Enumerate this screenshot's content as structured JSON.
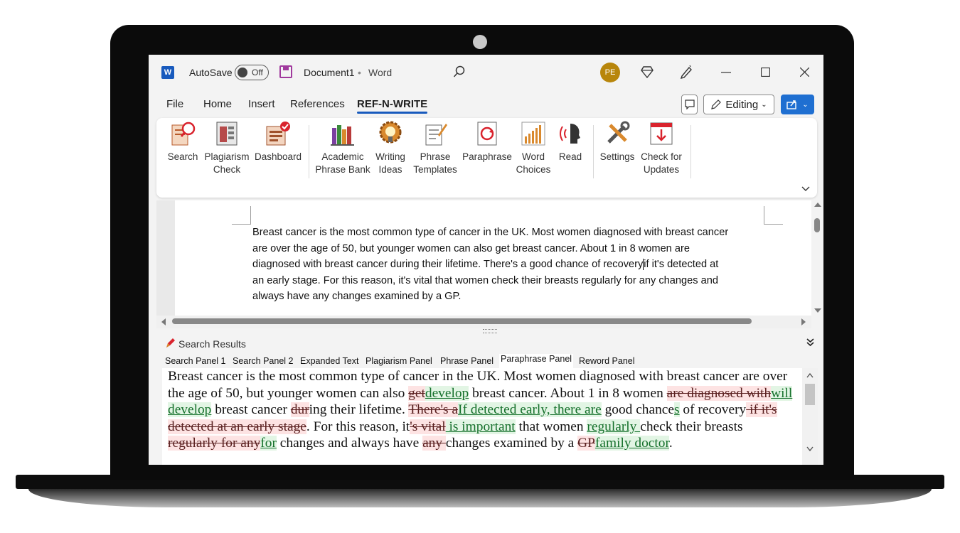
{
  "titlebar": {
    "autosave_label": "AutoSave",
    "autosave_state": "Off",
    "document_name": "Document1",
    "separator": "•",
    "app_name": "Word",
    "avatar_initials": "PE"
  },
  "menu_tabs": [
    "File",
    "Home",
    "Insert",
    "References",
    "REF-N-WRITE"
  ],
  "active_tab": "REF-N-WRITE",
  "toolbar": {
    "editing_label": "Editing"
  },
  "ribbon": {
    "buttons": [
      {
        "line1": "Search",
        "line2": ""
      },
      {
        "line1": "Plagiarism",
        "line2": "Check"
      },
      {
        "line1": "Dashboard",
        "line2": ""
      },
      {
        "line1": "Academic",
        "line2": "Phrase Bank"
      },
      {
        "line1": "Writing",
        "line2": "Ideas"
      },
      {
        "line1": "Phrase",
        "line2": "Templates"
      },
      {
        "line1": "Paraphrase",
        "line2": ""
      },
      {
        "line1": "Word",
        "line2": "Choices"
      },
      {
        "line1": "Read",
        "line2": ""
      },
      {
        "line1": "Settings",
        "line2": ""
      },
      {
        "line1": "Check for",
        "line2": "Updates"
      }
    ]
  },
  "document": {
    "line1": "Breast cancer is the most common type of cancer in the UK. Most women diagnosed with breast cancer",
    "line2": "are over the age of 50, but younger women can also get breast cancer. About 1 in 8 women are",
    "line3a": "diagnosed with breast cancer during their lifetime. There's a good chance of recovery",
    "line3b": "if it's detected at",
    "line4": "an early stage. For this reason, it's vital that women check their breasts regularly for any changes and",
    "line5": "always have any changes examined by a GP."
  },
  "panel": {
    "title": "Search Results",
    "tabs": [
      "Search Panel 1",
      "Search Panel 2",
      "Expanded Text",
      "Plagiarism Panel",
      "Phrase Panel",
      "Paraphrase Panel",
      "Reword Panel"
    ],
    "active_tab": "Paraphrase Panel"
  },
  "paraphrase": {
    "s1": "Breast cancer is the most common type of cancer in the UK. Most women diagnosed with breast cancer are over the age of 50, but younger women can also ",
    "d1": "get",
    "i1": "develop",
    "s2": " breast cancer. About 1 in 8 women ",
    "d2": "are diagnosed with",
    "i2": "will develop",
    "s3": " breast cancer ",
    "d3": "dur",
    "s4": "ing their lifetime. ",
    "d4": "There's a",
    "i3": "If detected early, there are",
    "s5": " good chance",
    "i4": "s",
    "s6": " of recovery",
    "d5": " if it's detected at an early stage",
    "s7": ". For this reason, it",
    "d6": "'s vital",
    "i5": " is important",
    "s8": " that women ",
    "i6": "regularly ",
    "s9": "check their breasts ",
    "d7": "regularly for any",
    "i7": "for",
    "s10": " changes and always have ",
    "d8": "any ",
    "s11": "changes examined by a ",
    "d9": "GP",
    "i8": "family doctor",
    "s12": "."
  },
  "colors": {
    "accent": "#185abd",
    "deleted_bg": "#fde3e3",
    "inserted_bg": "#e2f5e4",
    "inserted_text": "#15702b"
  }
}
